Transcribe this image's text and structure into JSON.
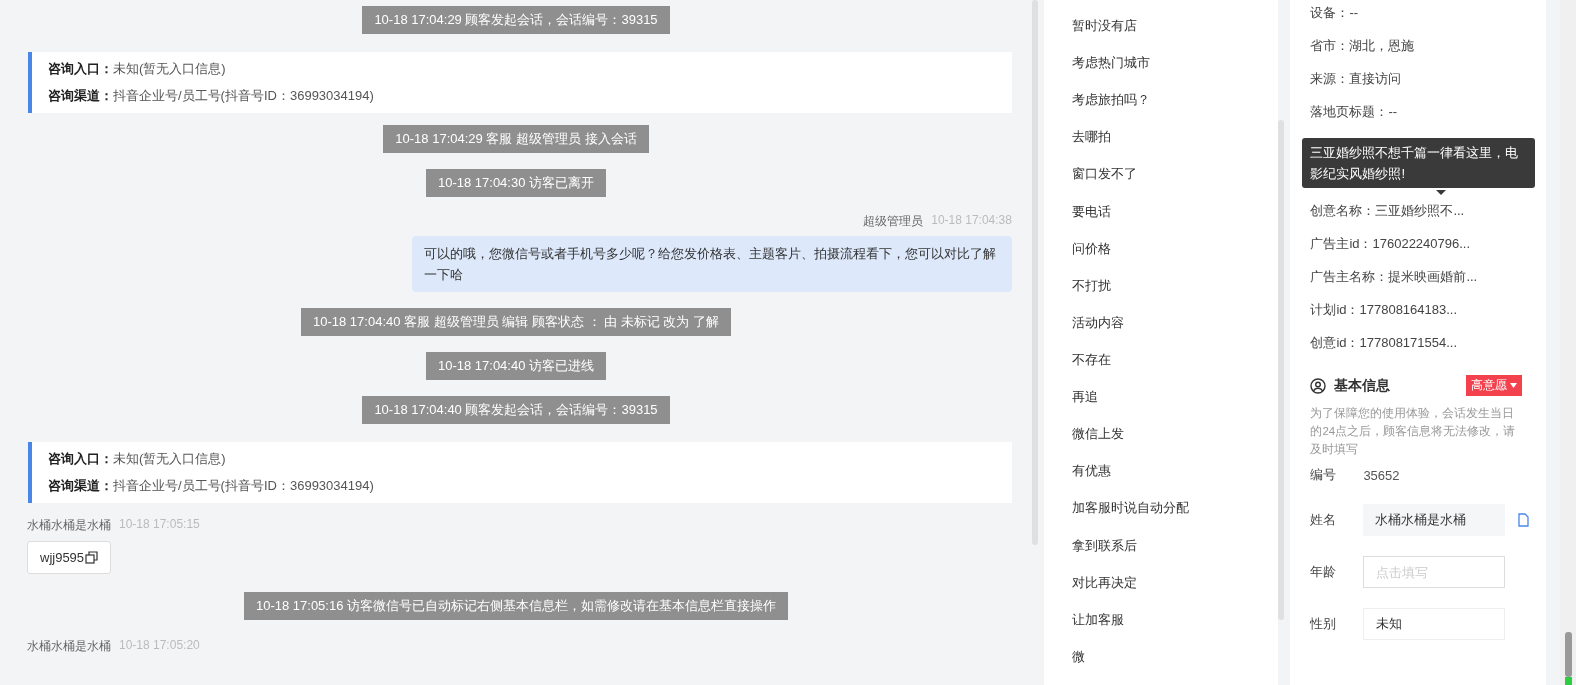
{
  "chat": {
    "messages": [
      {
        "kind": "system",
        "text": "10-18 17:04:29 顾客发起会话，会话编号：39315"
      },
      {
        "kind": "info",
        "fields": [
          {
            "label": "咨询入口：",
            "value": "未知(暂无入口信息)"
          },
          {
            "label": "咨询渠道：",
            "value": "抖音企业号/员工号(抖音号ID：36993034194)"
          }
        ]
      },
      {
        "kind": "system",
        "text": "10-18 17:04:29 客服 超级管理员 接入会话"
      },
      {
        "kind": "system",
        "text": "10-18 17:04:30 访客已离开"
      },
      {
        "kind": "outgoing",
        "sender": "超级管理员",
        "time": "10-18 17:04:38",
        "text": "可以的哦，您微信号或者手机号多少呢？给您发价格表、主题客片、拍摄流程看下，您可以对比了解一下哈"
      },
      {
        "kind": "system",
        "text": "10-18 17:04:40 客服 超级管理员 编辑 顾客状态 ： 由 未标记 改为 了解"
      },
      {
        "kind": "system",
        "text": "10-18 17:04:40 访客已进线"
      },
      {
        "kind": "system",
        "text": "10-18 17:04:40 顾客发起会话，会话编号：39315"
      },
      {
        "kind": "info",
        "fields": [
          {
            "label": "咨询入口：",
            "value": "未知(暂无入口信息)"
          },
          {
            "label": "咨询渠道：",
            "value": "抖音企业号/员工号(抖音号ID：36993034194)"
          }
        ]
      },
      {
        "kind": "incoming",
        "sender": "水桶水桶是水桶",
        "time": "10-18 17:05:15",
        "text": "wjj9595"
      },
      {
        "kind": "system",
        "text": "10-18 17:05:16 访客微信号已自动标记右侧基本信息栏，如需修改请在基本信息栏直接操作"
      },
      {
        "kind": "incoming",
        "sender": "水桶水桶是水桶",
        "time": "10-18 17:05:20"
      }
    ]
  },
  "tags": [
    "暂时没有店",
    "考虑热门城市",
    "考虑旅拍吗？",
    "去哪拍",
    "窗口发不了",
    "要电话",
    "问价格",
    "不打扰",
    "活动内容",
    "不存在",
    "再追",
    "微信上发",
    "有优惠",
    "加客服时说自动分配",
    "拿到联系后",
    "对比再决定",
    "让加客服",
    "微"
  ],
  "ad_info": {
    "rows_above": [
      {
        "text": "设备：--"
      },
      {
        "text": "省市：湖北，恩施"
      },
      {
        "text": "来源：直接访问"
      },
      {
        "text": "落地页标题：--"
      }
    ],
    "rows_below": [
      {
        "text": "创意名称：三亚婚纱照不..."
      },
      {
        "text": "广告主id：176022240796..."
      },
      {
        "text": "广告主名称：提米映画婚前..."
      },
      {
        "text": "计划id：177808164183..."
      },
      {
        "text": "创意id：177808171554..."
      }
    ],
    "tooltip": "三亚婚纱照不想千篇一律看这里，电影纪实风婚纱照!"
  },
  "basic_info": {
    "title": "基本信息",
    "intent": "高意愿",
    "note": "为了保障您的使用体验，会话发生当日的24点之后，顾客信息将无法修改，请及时填写",
    "fields": [
      {
        "kind": "text",
        "label": "编号",
        "value": "35652"
      },
      {
        "kind": "filled",
        "label": "姓名",
        "value": "水桶水桶是水桶"
      },
      {
        "kind": "input",
        "label": "年龄",
        "placeholder": "点击填写"
      },
      {
        "kind": "select",
        "label": "性别",
        "value": "未知"
      }
    ]
  }
}
